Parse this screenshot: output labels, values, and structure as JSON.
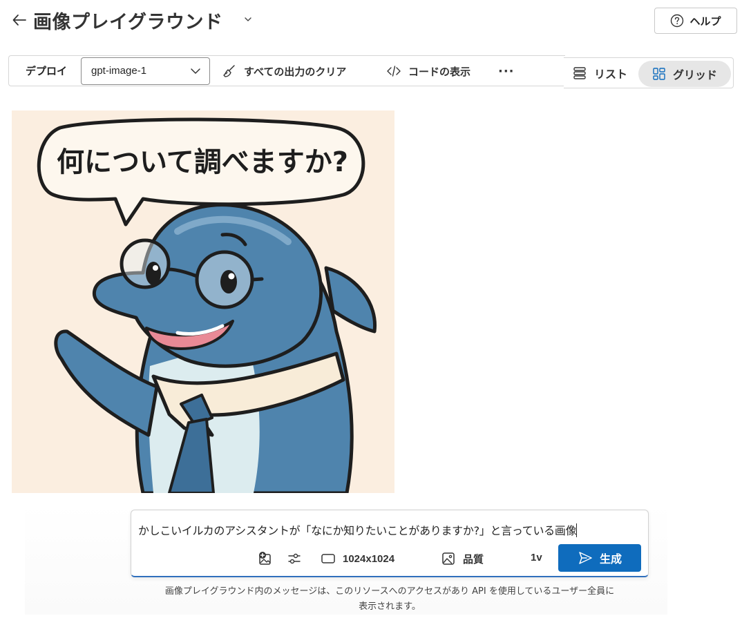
{
  "header": {
    "title": "画像プレイグラウンド",
    "help_label": "ヘルプ"
  },
  "toolbar": {
    "deploy_label": "デプロイ",
    "deployment_value": "gpt-image-1",
    "clear_label": "すべての出力のクリア",
    "code_label": "コードの表示",
    "more_label": "···"
  },
  "view": {
    "list_label": "リスト",
    "grid_label": "グリッド",
    "selected": "grid"
  },
  "image": {
    "speech_text": "何について調べますか?"
  },
  "composer": {
    "prompt_value": "かしこいイルカのアシスタントが「なにか知りたいことがありますか?」と言っている画像",
    "size_label": "1024x1024",
    "quality_label": "品質",
    "count_label": "1v",
    "generate_label": "生成"
  },
  "notice": {
    "line1": "画像プレイグラウンド内のメッセージは、このリソースへのアクセスがあり API を使用しているユーザー全員に",
    "line2": "表示されます。"
  },
  "colors": {
    "accent": "#0f6cbd",
    "image_background": "#fbeee0",
    "dolphin_blue": "#4f84ad"
  },
  "icons": [
    "back-arrow-icon",
    "chevron-down-icon",
    "help-icon",
    "broom-icon",
    "code-icon",
    "more-icon",
    "list-icon",
    "grid-icon",
    "image-add-icon",
    "settings-sliders-icon",
    "aspect-ratio-icon",
    "image-icon",
    "send-icon"
  ]
}
